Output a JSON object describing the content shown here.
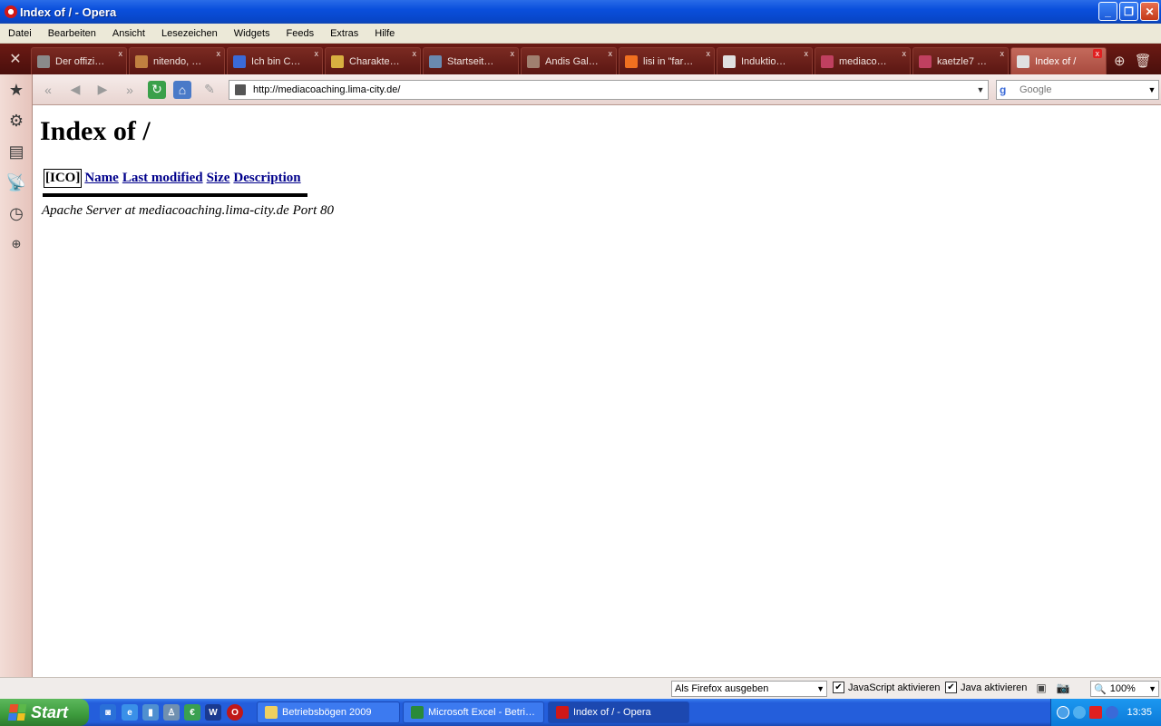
{
  "window": {
    "title": "Index of / - Opera"
  },
  "menubar": [
    "Datei",
    "Bearbeiten",
    "Ansicht",
    "Lesezeichen",
    "Widgets",
    "Feeds",
    "Extras",
    "Hilfe"
  ],
  "tabs": [
    {
      "label": "Der offizi…",
      "icon_color": "#8a8a8a"
    },
    {
      "label": "nitendo, …",
      "icon_color": "#c08040"
    },
    {
      "label": "Ich bin C…",
      "icon_color": "#3a6ad8"
    },
    {
      "label": "Charakte…",
      "icon_color": "#d8b040"
    },
    {
      "label": "Startseit…",
      "icon_color": "#6a8ab0"
    },
    {
      "label": "Andis Gal…",
      "icon_color": "#a08070"
    },
    {
      "label": "lisi in \"far…",
      "icon_color": "#f07020"
    },
    {
      "label": "Induktio…",
      "icon_color": "#e0e0e0"
    },
    {
      "label": "mediaco…",
      "icon_color": "#c04060"
    },
    {
      "label": "kaetzle7 …",
      "icon_color": "#c04060"
    },
    {
      "label": "Index of /",
      "icon_color": "#e0e0e0",
      "active": true
    }
  ],
  "address": {
    "url": "http://mediacoaching.lima-city.de/"
  },
  "search": {
    "placeholder": "Google"
  },
  "page": {
    "heading": "Index of /",
    "columns": {
      "ico": "[ICO]",
      "name": "Name",
      "modified": "Last modified",
      "size": "Size",
      "description": "Description"
    },
    "footer": "Apache Server at mediacoaching.lima-city.de Port 80"
  },
  "statusbar": {
    "identify_as": "Als Firefox ausgeben",
    "javascript": "JavaScript aktivieren",
    "java": "Java aktivieren",
    "zoom": "100%"
  },
  "taskbar": {
    "start": "Start",
    "tasks": [
      {
        "label": "Betriebsbögen 2009",
        "icon_color": "#f0d060"
      },
      {
        "label": "Microsoft Excel - Betri…",
        "icon_color": "#2a8a3a"
      },
      {
        "label": "Index of / - Opera",
        "icon_color": "#d01818",
        "active": true
      }
    ],
    "clock": "13:35"
  }
}
